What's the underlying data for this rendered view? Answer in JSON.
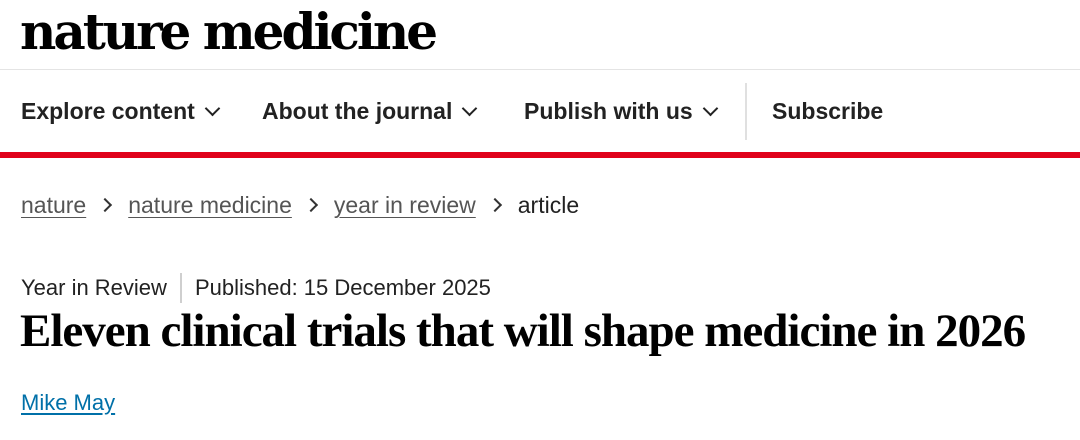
{
  "header": {
    "logo_text": "nature medicine"
  },
  "nav": {
    "items": [
      {
        "label": "Explore content",
        "has_dropdown": true
      },
      {
        "label": "About the journal",
        "has_dropdown": true
      },
      {
        "label": "Publish with us",
        "has_dropdown": true
      },
      {
        "label": "Subscribe",
        "has_dropdown": false
      }
    ]
  },
  "breadcrumb": {
    "items": [
      {
        "label": "nature"
      },
      {
        "label": "nature medicine"
      },
      {
        "label": "year in review"
      },
      {
        "label": "article"
      }
    ]
  },
  "article": {
    "type": "Year in Review",
    "published": "Published: 15 December 2025",
    "title": "Eleven clinical trials that will shape medicine in 2026",
    "author": "Mike May"
  },
  "colors": {
    "accent_red": "#e0021b",
    "link_blue": "#0070a8"
  }
}
